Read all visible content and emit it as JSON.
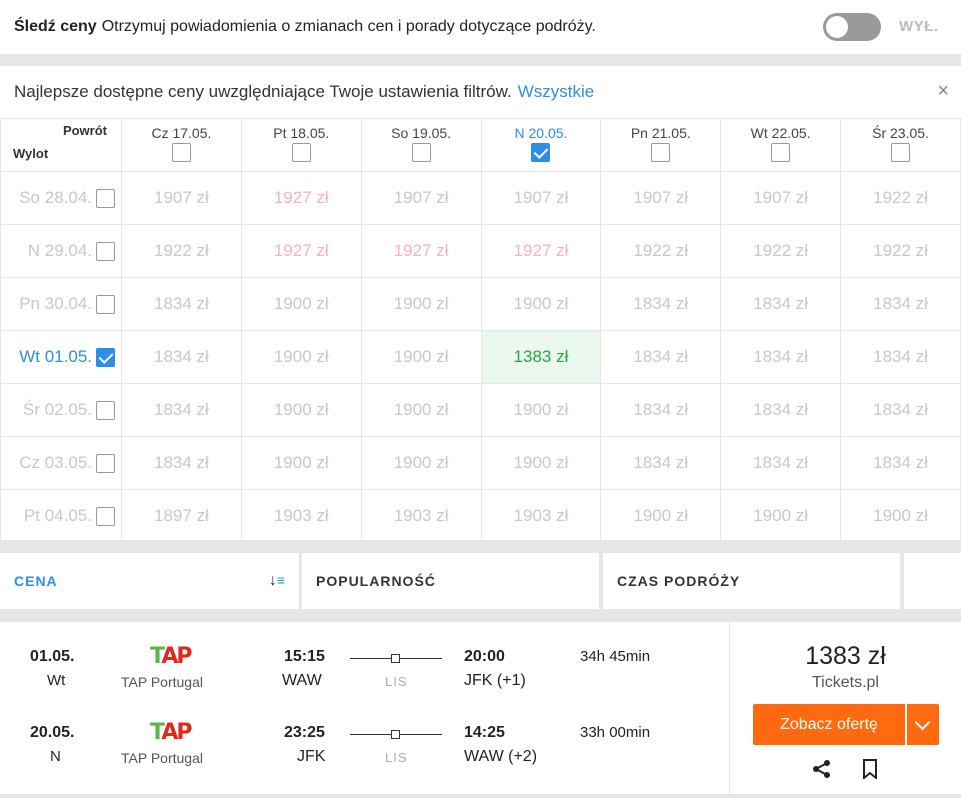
{
  "alert": {
    "title": "Śledź ceny",
    "description": "Otrzymuj powiadomienia o zmianach cen i porady dotyczące podróży.",
    "toggle_label": "WYŁ."
  },
  "grid": {
    "header_text": "Najlepsze dostępne ceny uwzględniające Twoje ustawienia filtrów.",
    "all_link": "Wszystkie",
    "close": "×",
    "corner_return": "Powrót",
    "corner_departure": "Wylot",
    "return_dates": [
      "Cz 17.05.",
      "Pt 18.05.",
      "So 19.05.",
      "N 20.05.",
      "Pn 21.05.",
      "Wt 22.05.",
      "Śr 23.05."
    ],
    "selected_return_index": 3,
    "rows": [
      {
        "date": "So 28.04.",
        "prices": [
          "1907 zł",
          "1927 zł",
          "1907 zł",
          "1907 zł",
          "1907 zł",
          "1907 zł",
          "1922 zł"
        ]
      },
      {
        "date": "N 29.04.",
        "prices": [
          "1922 zł",
          "1927 zł",
          "1927 zł",
          "1927 zł",
          "1922 zł",
          "1922 zł",
          "1922 zł"
        ]
      },
      {
        "date": "Pn 30.04.",
        "prices": [
          "1834 zł",
          "1900 zł",
          "1900 zł",
          "1900 zł",
          "1834 zł",
          "1834 zł",
          "1834 zł"
        ]
      },
      {
        "date": "Wt 01.05.",
        "prices": [
          "1834 zł",
          "1900 zł",
          "1900 zł",
          "1383 zł",
          "1834 zł",
          "1834 zł",
          "1834 zł"
        ]
      },
      {
        "date": "Śr 02.05.",
        "prices": [
          "1834 zł",
          "1900 zł",
          "1900 zł",
          "1900 zł",
          "1834 zł",
          "1834 zł",
          "1834 zł"
        ]
      },
      {
        "date": "Cz 03.05.",
        "prices": [
          "1834 zł",
          "1900 zł",
          "1900 zł",
          "1900 zł",
          "1834 zł",
          "1834 zł",
          "1834 zł"
        ]
      },
      {
        "date": "Pt 04.05.",
        "prices": [
          "1897 zł",
          "1903 zł",
          "1903 zł",
          "1903 zł",
          "1900 zł",
          "1900 zł",
          "1900 zł"
        ]
      }
    ],
    "selected_departure_index": 3
  },
  "sort": {
    "price": "CENA",
    "popularity": "POPULARNOŚĆ",
    "duration": "CZAS PODRÓŻY"
  },
  "result": {
    "legs": [
      {
        "date": "01.05.",
        "dow": "Wt",
        "airline": "TAP Portugal",
        "dep_time": "15:15",
        "dep_airport": "WAW",
        "via": "LIS",
        "arr_time": "20:00",
        "arr_airport": "JFK (+1)",
        "duration": "34h 45min"
      },
      {
        "date": "20.05.",
        "dow": "N",
        "airline": "TAP Portugal",
        "dep_time": "23:25",
        "dep_airport": "JFK",
        "via": "LIS",
        "arr_time": "14:25",
        "arr_airport": "WAW (+2)",
        "duration": "33h 00min"
      }
    ],
    "price": "1383 zł",
    "provider": "Tickets.pl",
    "cta": "Zobacz ofertę"
  }
}
